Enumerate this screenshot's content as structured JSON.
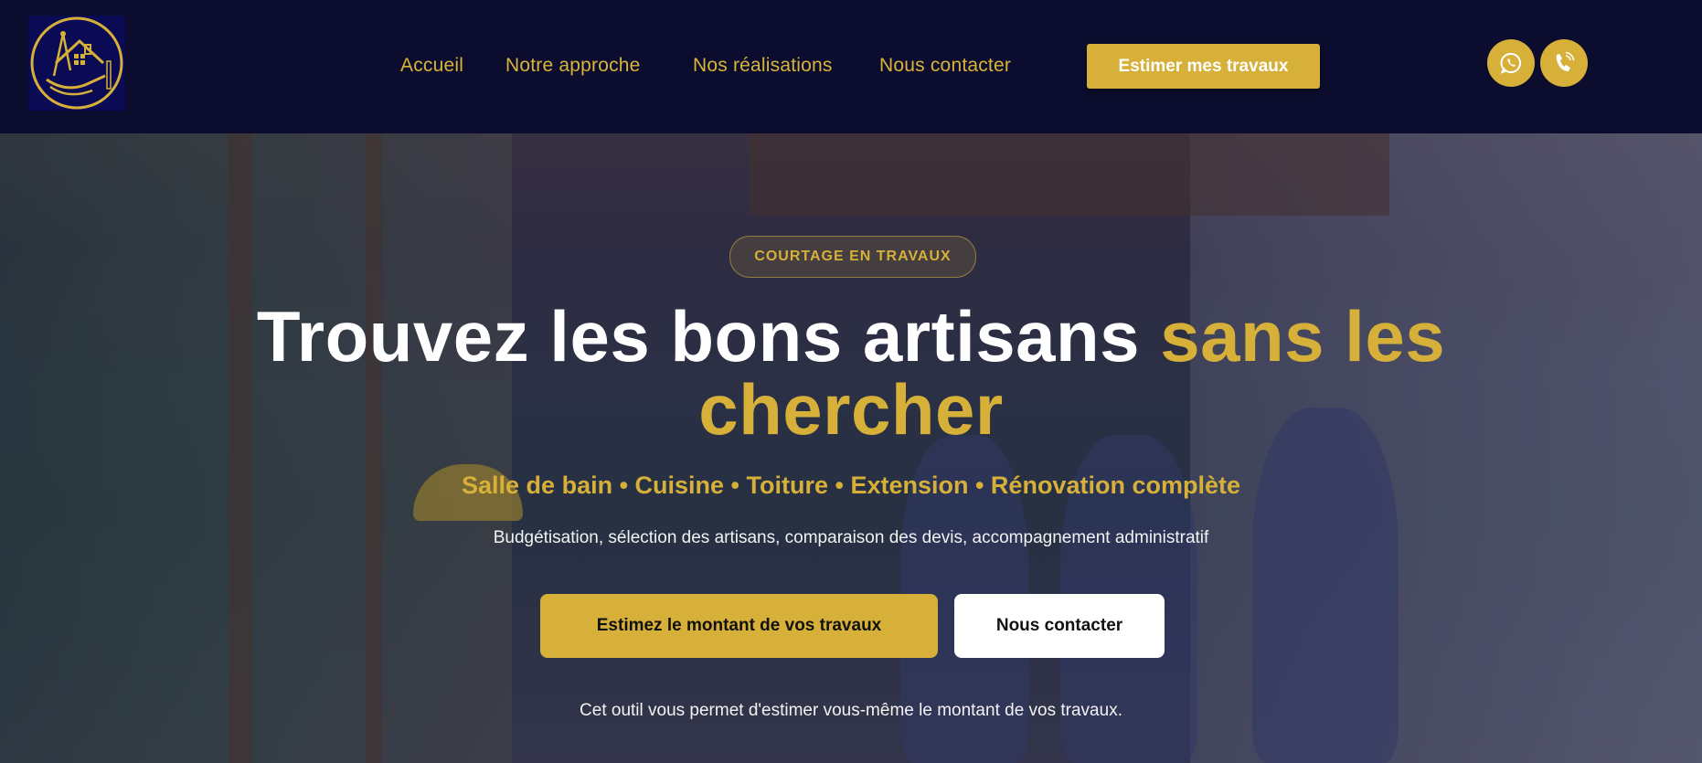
{
  "brand": {
    "accent": "#d6b039",
    "header_bg": "#0c0d2e",
    "logo_icon": "house-compass-hand-logo"
  },
  "nav": {
    "items": [
      {
        "label": "Accueil"
      },
      {
        "label": "Notre approche"
      },
      {
        "label": "Nos réalisations"
      },
      {
        "label": "Nous contacter"
      }
    ],
    "cta_label": "Estimer mes travaux",
    "whatsapp_icon": "whatsapp-icon",
    "phone_icon": "phone-icon"
  },
  "hero": {
    "badge": "COURTAGE EN TRAVAUX",
    "headline_white": "Trouvez les bons artisans ",
    "headline_gold": "sans les chercher",
    "services": "Salle de bain • Cuisine • Toiture • Extension • Rénovation complète",
    "subline": "Budgétisation, sélection des artisans, comparaison des devis, accompagnement administratif",
    "primary_button": "Estimez le montant de vos travaux",
    "secondary_button": "Nous contacter",
    "footnote": "Cet outil vous permet d'estimer vous-même le montant de vos travaux."
  }
}
